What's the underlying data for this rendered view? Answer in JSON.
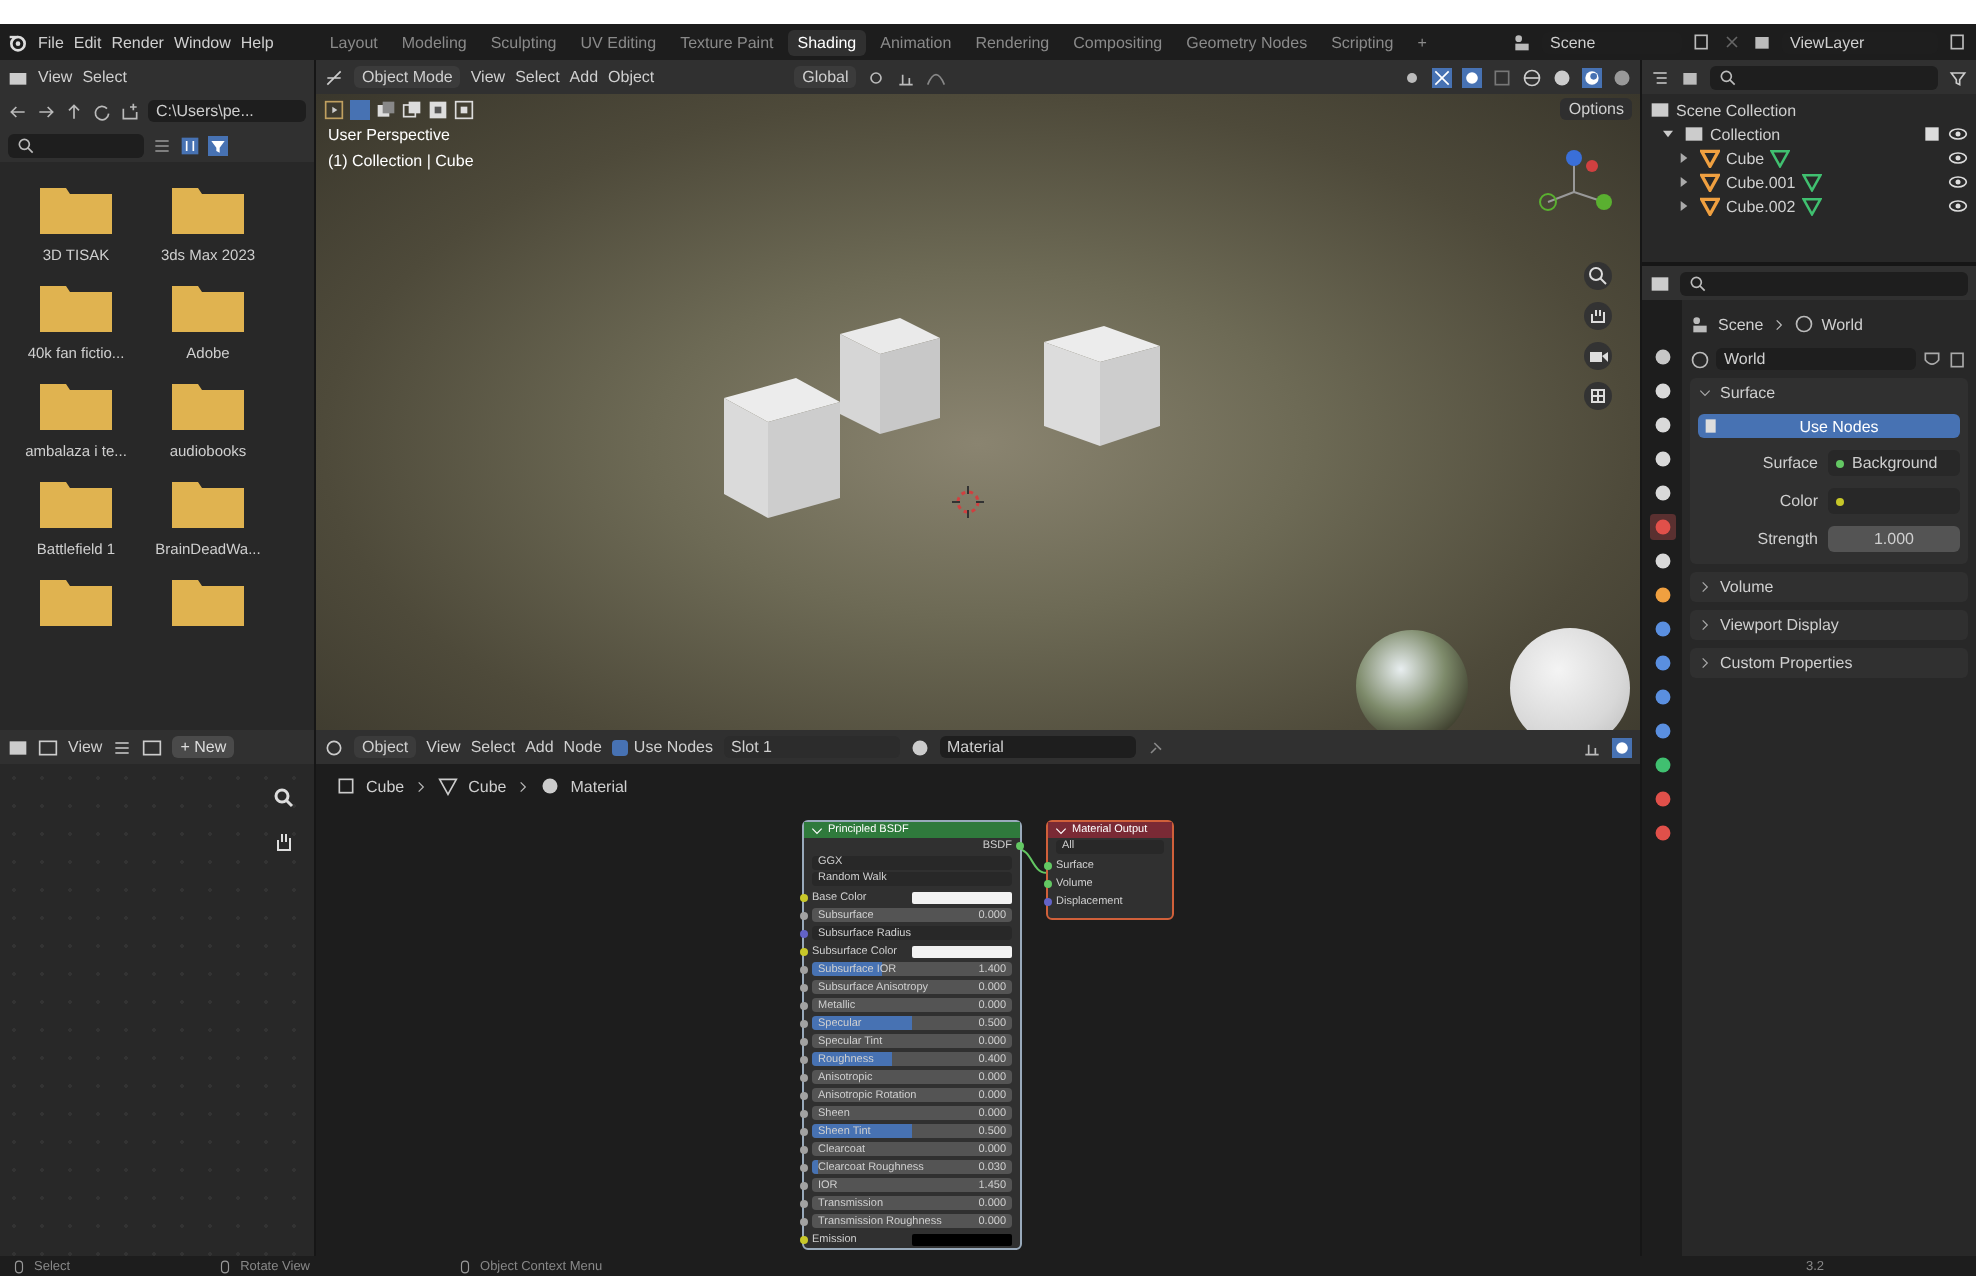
{
  "topbar": {
    "menus": [
      "File",
      "Edit",
      "Render",
      "Window",
      "Help"
    ],
    "workspaces": [
      {
        "label": "Layout",
        "selected": false
      },
      {
        "label": "Modeling",
        "selected": false
      },
      {
        "label": "Sculpting",
        "selected": false
      },
      {
        "label": "UV Editing",
        "selected": false
      },
      {
        "label": "Texture Paint",
        "selected": false
      },
      {
        "label": "Shading",
        "selected": true
      },
      {
        "label": "Animation",
        "selected": false
      },
      {
        "label": "Rendering",
        "selected": false
      },
      {
        "label": "Compositing",
        "selected": false
      },
      {
        "label": "Geometry Nodes",
        "selected": false
      },
      {
        "label": "Scripting",
        "selected": false
      }
    ],
    "add_tab": "+",
    "scene": "Scene",
    "view_layer": "ViewLayer"
  },
  "file_browser": {
    "menus": [
      "View",
      "Select"
    ],
    "path": "C:\\Users\\pe...",
    "folders": [
      {
        "name": "3D TISAK"
      },
      {
        "name": "3ds Max 2023"
      },
      {
        "name": "40k fan fictio..."
      },
      {
        "name": "Adobe"
      },
      {
        "name": "ambalaza i te..."
      },
      {
        "name": "audiobooks"
      },
      {
        "name": "Battlefield 1"
      },
      {
        "name": "BrainDeadWa..."
      }
    ]
  },
  "viewport": {
    "mode": "Object Mode",
    "menus": [
      "View",
      "Select",
      "Add",
      "Object"
    ],
    "orientation": "Global",
    "options": "Options",
    "view_name": "User Perspective",
    "context": "(1) Collection | Cube"
  },
  "outliner": {
    "root": "Scene Collection",
    "tree": [
      {
        "name": "Collection",
        "expanded": true,
        "children": [
          {
            "name": "Cube"
          },
          {
            "name": "Cube.001"
          },
          {
            "name": "Cube.002"
          }
        ]
      }
    ]
  },
  "properties": {
    "tabs": [
      {
        "kind": "tool",
        "selected": false
      },
      {
        "kind": "render",
        "selected": false
      },
      {
        "kind": "output",
        "selected": false
      },
      {
        "kind": "view_layer",
        "selected": false
      },
      {
        "kind": "scene",
        "selected": false
      },
      {
        "kind": "world",
        "selected": true
      },
      {
        "kind": "collection",
        "selected": false
      },
      {
        "kind": "object",
        "selected": false
      },
      {
        "kind": "modifier",
        "selected": false
      },
      {
        "kind": "particles",
        "selected": false
      },
      {
        "kind": "physics",
        "selected": false
      },
      {
        "kind": "constraints",
        "selected": false
      },
      {
        "kind": "data",
        "selected": false
      },
      {
        "kind": "material",
        "selected": false
      },
      {
        "kind": "texture",
        "selected": false
      }
    ],
    "breadcrumb": [
      "Scene",
      "World"
    ],
    "world_name": "World",
    "panels": [
      {
        "title": "Surface",
        "expanded": true
      },
      {
        "title": "Volume",
        "expanded": false
      },
      {
        "title": "Viewport Display",
        "expanded": false
      },
      {
        "title": "Custom Properties",
        "expanded": false
      }
    ],
    "use_nodes": "Use Nodes",
    "surface_label": "Surface",
    "surface_value": "Background",
    "color_label": "Color",
    "strength_label": "Strength",
    "strength_value": "1.000"
  },
  "image_editor": {
    "view": "View",
    "new": "New",
    "new_icon": "+"
  },
  "node_editor": {
    "object": "Object",
    "menus": [
      "View",
      "Select",
      "Add",
      "Node"
    ],
    "use_nodes": {
      "label": "Use Nodes",
      "checked": true
    },
    "slot": "Slot 1",
    "material": "Material",
    "breadcrumb": [
      "Cube",
      "Cube",
      "Material"
    ],
    "principled": {
      "title": "Principled BSDF",
      "output": "BSDF",
      "dropdowns": [
        "GGX",
        "Random Walk"
      ],
      "inputs": [
        {
          "kind": "color",
          "label": "Base Color",
          "color": "#f2f2f2"
        },
        {
          "kind": "value",
          "label": "Subsurface",
          "value": "0.000",
          "level": 0
        },
        {
          "kind": "vector",
          "label": "Subsurface Radius"
        },
        {
          "kind": "color",
          "label": "Subsurface Color",
          "color": "#f2f2f2"
        },
        {
          "kind": "value",
          "label": "Subsurface IOR",
          "value": "1.400",
          "level": 0.35
        },
        {
          "kind": "value",
          "label": "Subsurface Anisotropy",
          "value": "0.000",
          "level": 0
        },
        {
          "kind": "value",
          "label": "Metallic",
          "value": "0.000",
          "level": 0
        },
        {
          "kind": "value",
          "label": "Specular",
          "value": "0.500",
          "level": 0.5
        },
        {
          "kind": "value",
          "label": "Specular Tint",
          "value": "0.000",
          "level": 0
        },
        {
          "kind": "value",
          "label": "Roughness",
          "value": "0.400",
          "level": 0.4
        },
        {
          "kind": "value",
          "label": "Anisotropic",
          "value": "0.000",
          "level": 0
        },
        {
          "kind": "value",
          "label": "Anisotropic Rotation",
          "value": "0.000",
          "level": 0
        },
        {
          "kind": "value",
          "label": "Sheen",
          "value": "0.000",
          "level": 0
        },
        {
          "kind": "value",
          "label": "Sheen Tint",
          "value": "0.500",
          "level": 0.5
        },
        {
          "kind": "value",
          "label": "Clearcoat",
          "value": "0.000",
          "level": 0
        },
        {
          "kind": "value",
          "label": "Clearcoat Roughness",
          "value": "0.030",
          "level": 0.03
        },
        {
          "kind": "value",
          "label": "IOR",
          "value": "1.450",
          "level": 0
        },
        {
          "kind": "value",
          "label": "Transmission",
          "value": "0.000",
          "level": 0
        },
        {
          "kind": "value",
          "label": "Transmission Roughness",
          "value": "0.000",
          "level": 0
        },
        {
          "kind": "color",
          "label": "Emission",
          "color": "#000000"
        }
      ]
    },
    "output": {
      "title": "Material Output",
      "target": "All",
      "inputs": [
        {
          "label": "Surface",
          "kind": "shader"
        },
        {
          "label": "Volume",
          "kind": "shader"
        },
        {
          "label": "Displacement",
          "kind": "vector"
        }
      ]
    }
  },
  "status_bar": {
    "items": [
      "Select",
      "Rotate View",
      "Object Context Menu"
    ],
    "version": "3.2"
  }
}
